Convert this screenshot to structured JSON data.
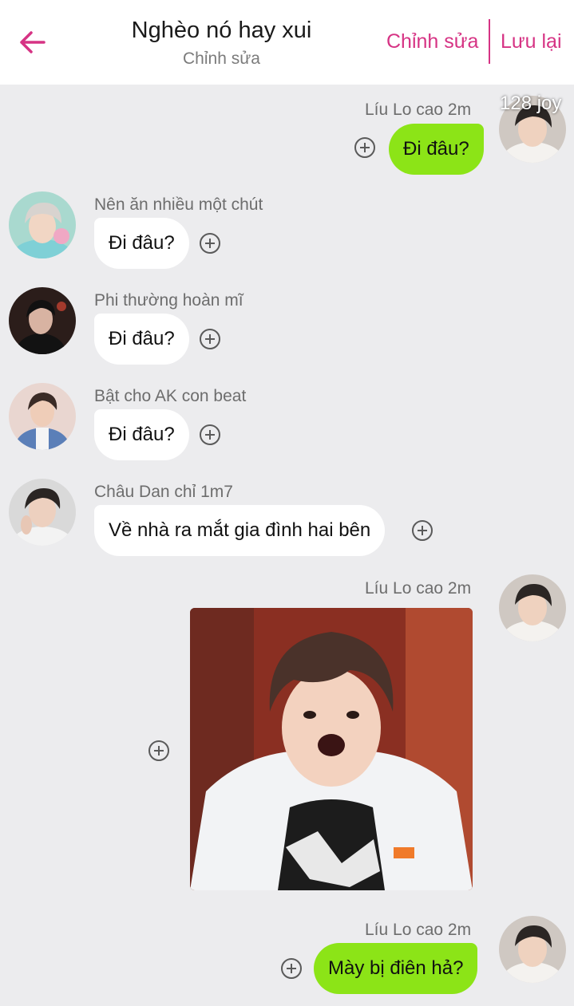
{
  "header": {
    "title": "Nghèo nó hay xui",
    "subtitle": "Chỉnh sửa",
    "edit_label": "Chỉnh sửa",
    "save_label": "Lưu lại"
  },
  "colors": {
    "accent": "#d63384",
    "outgoing_bubble": "#8ce417",
    "incoming_bubble": "#ffffff",
    "background": "#ececee"
  },
  "watermark": "128 joy",
  "messages": [
    {
      "direction": "outgoing",
      "sender": "Líu Lo cao 2m",
      "text": "Đi đâu?"
    },
    {
      "direction": "incoming",
      "sender": "Nên ăn nhiều một chút",
      "text": "Đi đâu?"
    },
    {
      "direction": "incoming",
      "sender": "Phi thường hoàn mĩ",
      "text": "Đi đâu?"
    },
    {
      "direction": "incoming",
      "sender": "Bật cho AK con beat",
      "text": "Đi đâu?"
    },
    {
      "direction": "incoming",
      "sender": "Châu Dan chỉ 1m7",
      "text": "Về nhà ra mắt gia đình hai bên"
    },
    {
      "direction": "outgoing",
      "sender": "Líu Lo cao 2m",
      "type": "image"
    },
    {
      "direction": "outgoing",
      "sender": "Líu Lo cao 2m",
      "text": "Mày bị điên hả?"
    }
  ]
}
